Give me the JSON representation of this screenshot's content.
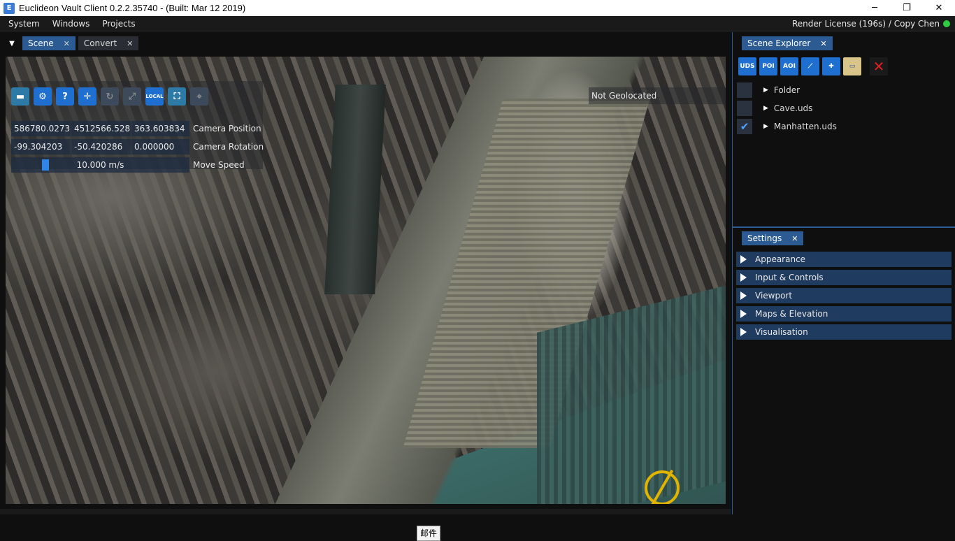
{
  "window": {
    "title": "Euclideon Vault Client 0.2.2.35740 - (Built: Mar 12 2019)",
    "minimize": "─",
    "maximize": "❐",
    "close": "✕"
  },
  "menu": {
    "items": [
      "System",
      "Windows",
      "Projects"
    ],
    "license": "Render License (196s) / Copy Chen",
    "status_color": "#2ecc40"
  },
  "scene_tabs": [
    {
      "label": "Scene",
      "close": "✕"
    },
    {
      "label": "Convert",
      "close": "✕"
    }
  ],
  "viewport": {
    "toolbar": {
      "local_label": "LOCAL"
    },
    "camera_position": {
      "x": "586780.027377",
      "y": "4512566.528125",
      "z": "363.603834",
      "label": "Camera Position"
    },
    "camera_rotation": {
      "x": "-99.304203",
      "y": "-50.420286",
      "z": "0.000000",
      "label": "Camera Rotation"
    },
    "move_speed": {
      "value": "10.000 m/s",
      "label": "Move Speed"
    },
    "geolocation": "Not Geolocated"
  },
  "tooltip": "邮件",
  "scene_explorer": {
    "tab_label": "Scene Explorer",
    "close": "✕",
    "toolbar": {
      "uds": "UDS",
      "poi": "POI",
      "aoi": "AOI",
      "delete": "✕"
    },
    "items": [
      {
        "label": "Folder",
        "checked": ""
      },
      {
        "label": "Cave.uds",
        "checked": ""
      },
      {
        "label": "Manhatten.uds",
        "checked": "✔"
      }
    ]
  },
  "settings": {
    "tab_label": "Settings",
    "close": "✕",
    "sections": [
      "Appearance",
      "Input & Controls",
      "Viewport",
      "Maps & Elevation",
      "Visualisation"
    ]
  },
  "accent_color": "#2c5b94"
}
